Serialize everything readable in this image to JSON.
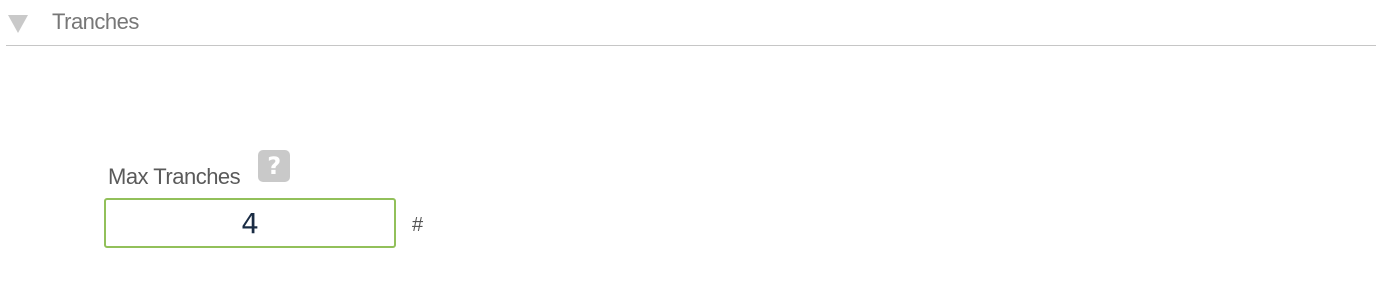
{
  "section": {
    "title": "Tranches",
    "caret_icon": "caret-down-icon"
  },
  "field": {
    "label": "Max Tranches",
    "help_icon": "question-mark-icon",
    "help_glyph": "?",
    "value": "4",
    "unit": "#"
  },
  "colors": {
    "input_border": "#92c05a",
    "value_text": "#1a2c44",
    "divider": "#c6c6c6"
  }
}
